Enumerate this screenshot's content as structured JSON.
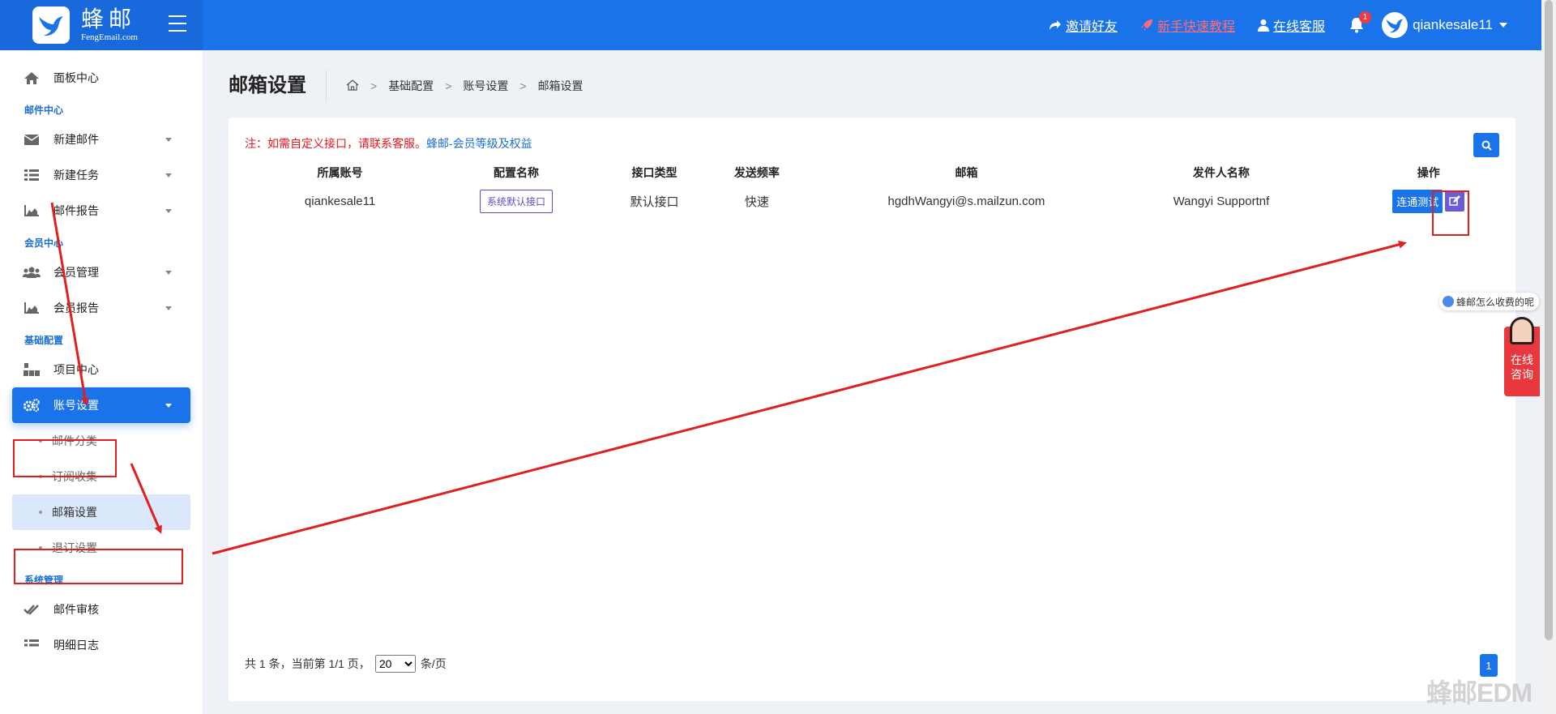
{
  "brand": {
    "name_cn": "蜂邮",
    "name_en": "FengEmail.com"
  },
  "header": {
    "invite_label": "邀请好友",
    "tutorial_label": "新手快速教程",
    "support_label": "在线客服",
    "notification_count": "1",
    "username": "qiankesale11"
  },
  "sidebar": {
    "dashboard": "面板中心",
    "section_mail": "邮件中心",
    "new_mail": "新建邮件",
    "new_task": "新建任务",
    "mail_report": "邮件报告",
    "section_member": "会员中心",
    "member_manage": "会员管理",
    "member_report": "会员报告",
    "section_base": "基础配置",
    "project_center": "项目中心",
    "account_settings": "账号设置",
    "sub_mail_category": "邮件分类",
    "sub_subscribe": "订阅收集",
    "sub_mailbox": "邮箱设置",
    "sub_unsubscribe": "退订设置",
    "section_system": "系统管理",
    "mail_review": "邮件审核",
    "operation_log": "明细日志"
  },
  "page": {
    "title": "邮箱设置",
    "breadcrumbs": [
      "基础配置",
      "账号设置",
      "邮箱设置"
    ]
  },
  "notice": {
    "text": "注：如需自定义接口，请联系客服。",
    "link": "蜂邮-会员等级及权益"
  },
  "table": {
    "headers": [
      "所属账号",
      "配置名称",
      "接口类型",
      "发送频率",
      "邮箱",
      "发件人名称",
      "操作"
    ],
    "rows": [
      {
        "account": "qiankesale11",
        "config_name": "系统默认接口",
        "interface_type": "默认接口",
        "frequency": "快速",
        "email": "hgdhWangyi@s.mailzun.com",
        "sender": "Wangyi Supportnf",
        "test_label": "连通测试"
      }
    ]
  },
  "pagination": {
    "summary": "共 1 条，当前第 1/1 页，",
    "page_size": "20",
    "per_page": "条/页",
    "current_page": "1"
  },
  "float": {
    "tip": "蜂邮怎么收费的呢",
    "service_line1": "在线",
    "service_line2": "咨询"
  },
  "watermark": "蜂邮EDM",
  "colors": {
    "primary": "#1a73e8",
    "annotation": "#e02020",
    "edit": "#6b5bd6"
  }
}
